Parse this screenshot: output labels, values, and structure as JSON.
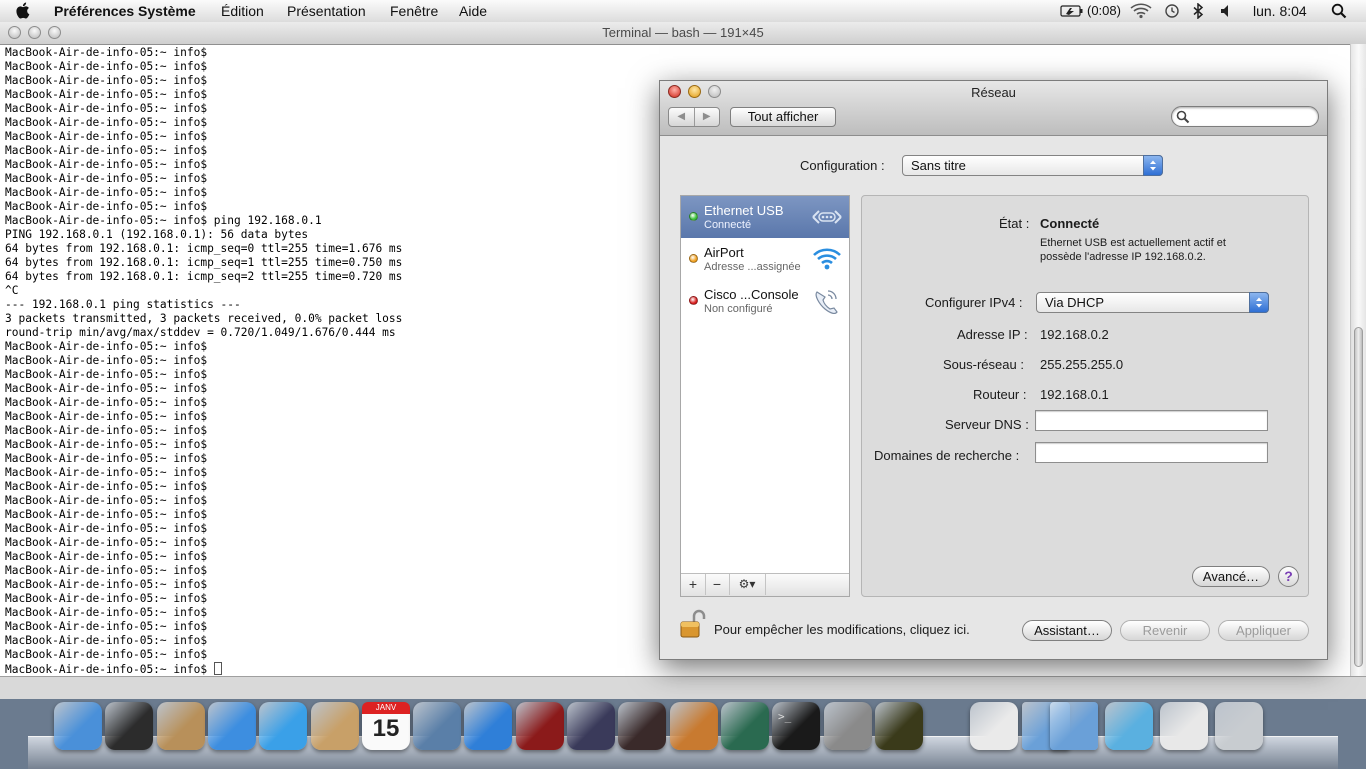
{
  "menubar": {
    "app": "Préférences Système",
    "items": [
      "Édition",
      "Présentation",
      "Fenêtre",
      "Aide"
    ],
    "battery": "(0:08)",
    "clock": "lun. 8:04"
  },
  "terminal": {
    "title": "Terminal — bash — 191×45",
    "lines": [
      "MacBook-Air-de-info-05:~ info$",
      "MacBook-Air-de-info-05:~ info$",
      "MacBook-Air-de-info-05:~ info$",
      "MacBook-Air-de-info-05:~ info$",
      "MacBook-Air-de-info-05:~ info$",
      "MacBook-Air-de-info-05:~ info$",
      "MacBook-Air-de-info-05:~ info$",
      "MacBook-Air-de-info-05:~ info$",
      "MacBook-Air-de-info-05:~ info$",
      "MacBook-Air-de-info-05:~ info$",
      "MacBook-Air-de-info-05:~ info$",
      "MacBook-Air-de-info-05:~ info$",
      "MacBook-Air-de-info-05:~ info$ ping 192.168.0.1",
      "PING 192.168.0.1 (192.168.0.1): 56 data bytes",
      "64 bytes from 192.168.0.1: icmp_seq=0 ttl=255 time=1.676 ms",
      "64 bytes from 192.168.0.1: icmp_seq=1 ttl=255 time=0.750 ms",
      "64 bytes from 192.168.0.1: icmp_seq=2 ttl=255 time=0.720 ms",
      "^C",
      "--- 192.168.0.1 ping statistics ---",
      "3 packets transmitted, 3 packets received, 0.0% packet loss",
      "round-trip min/avg/max/stddev = 0.720/1.049/1.676/0.444 ms",
      "MacBook-Air-de-info-05:~ info$",
      "MacBook-Air-de-info-05:~ info$",
      "MacBook-Air-de-info-05:~ info$",
      "MacBook-Air-de-info-05:~ info$",
      "MacBook-Air-de-info-05:~ info$",
      "MacBook-Air-de-info-05:~ info$",
      "MacBook-Air-de-info-05:~ info$",
      "MacBook-Air-de-info-05:~ info$",
      "MacBook-Air-de-info-05:~ info$",
      "MacBook-Air-de-info-05:~ info$",
      "MacBook-Air-de-info-05:~ info$",
      "MacBook-Air-de-info-05:~ info$",
      "MacBook-Air-de-info-05:~ info$",
      "MacBook-Air-de-info-05:~ info$",
      "MacBook-Air-de-info-05:~ info$",
      "MacBook-Air-de-info-05:~ info$",
      "MacBook-Air-de-info-05:~ info$",
      "MacBook-Air-de-info-05:~ info$",
      "MacBook-Air-de-info-05:~ info$",
      "MacBook-Air-de-info-05:~ info$",
      "MacBook-Air-de-info-05:~ info$",
      "MacBook-Air-de-info-05:~ info$",
      "MacBook-Air-de-info-05:~ info$",
      "MacBook-Air-de-info-05:~ info$ "
    ]
  },
  "network": {
    "window_title": "Réseau",
    "show_all": "Tout afficher",
    "search_placeholder": "",
    "config_label": "Configuration :",
    "config_value": "Sans titre",
    "services": [
      {
        "name": "Ethernet USB",
        "status": "Connecté",
        "color": "#3cc23c"
      },
      {
        "name": "AirPort",
        "status": "Adresse ...assignée",
        "color": "#f0a020"
      },
      {
        "name": "Cisco ...Console",
        "status": "Non configuré",
        "color": "#d81e1e"
      }
    ],
    "list_buttons": {
      "add": "+",
      "remove": "−",
      "gear": "⚙▾"
    },
    "state_label": "État :",
    "state_value": "Connecté",
    "state_desc_1": "Ethernet USB est actuellement actif et",
    "state_desc_2": "possède l'adresse IP 192.168.0.2.",
    "ipv4_label": "Configurer IPv4 :",
    "ipv4_value": "Via DHCP",
    "ip_label": "Adresse IP :",
    "ip_value": "192.168.0.2",
    "subnet_label": "Sous-réseau :",
    "subnet_value": "255.255.255.0",
    "router_label": "Routeur :",
    "router_value": "192.168.0.1",
    "dns_label": "Serveur DNS :",
    "dns_value": "",
    "domains_label": "Domaines de recherche :",
    "domains_value": "",
    "advanced": "Avancé…",
    "help": "?",
    "lock_text": "Pour empêcher les modifications, cliquez ici.",
    "assistant": "Assistant…",
    "revert": "Revenir",
    "apply": "Appliquer"
  },
  "dock": {
    "calendar_month": "JANV",
    "calendar_day": "15",
    "icons": [
      "finder-icon",
      "dashboard-icon",
      "mail-icon",
      "safari-icon",
      "facetime-icon",
      "address-book-icon",
      "ical-icon",
      "iphoto-icon",
      "itunes-icon",
      "front-row-icon",
      "imovie-icon",
      "photo-booth-icon",
      "garageband-icon",
      "time-machine-icon",
      "terminal-icon",
      "system-preferences-icon",
      "cable-icon",
      "textedit-icon",
      "applications-folder-icon",
      "documents-folder-icon",
      "no-entry-icon",
      "network-stack-icon",
      "trash-icon"
    ]
  }
}
